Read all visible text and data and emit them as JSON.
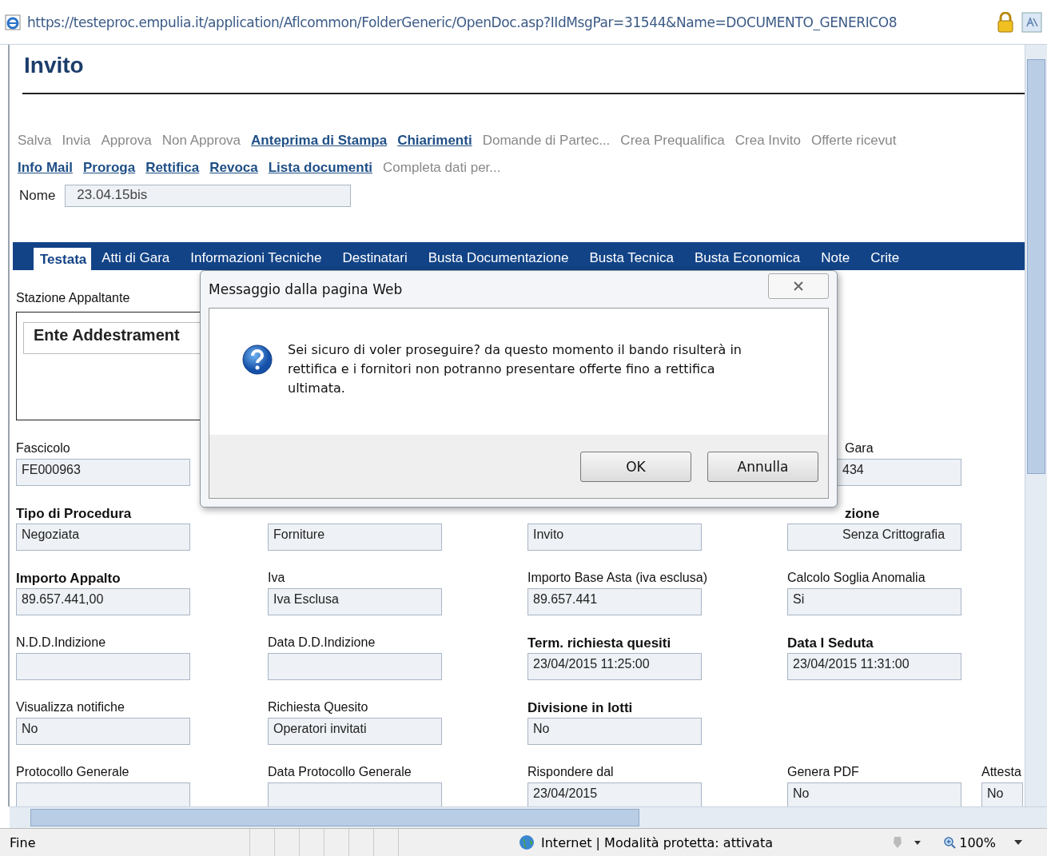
{
  "address_bar": {
    "url": "https://testeproc.empulia.it/application/Aflcommon/FolderGeneric/OpenDoc.asp?IIdMsgPar=31544&Name=DOCUMENTO_GENERICO8"
  },
  "page": {
    "title": "Invito",
    "toolbar": [
      [
        {
          "label": "Salva",
          "disabled": true
        },
        {
          "label": "Invia",
          "disabled": true
        },
        {
          "label": "Approva",
          "disabled": true
        },
        {
          "label": "Non Approva",
          "disabled": true
        },
        {
          "label": "Anteprima di Stampa",
          "disabled": false
        },
        {
          "label": "Chiarimenti",
          "disabled": false
        },
        {
          "label": "Domande di Partec...",
          "disabled": true
        },
        {
          "label": "Crea Prequalifica",
          "disabled": true
        },
        {
          "label": "Crea Invito",
          "disabled": true
        },
        {
          "label": "Offerte ricevut",
          "disabled": true
        }
      ],
      [
        {
          "label": "Info Mail",
          "disabled": false
        },
        {
          "label": "Proroga",
          "disabled": false
        },
        {
          "label": "Rettifica",
          "disabled": false
        },
        {
          "label": "Revoca",
          "disabled": false
        },
        {
          "label": "Lista documenti",
          "disabled": false
        },
        {
          "label": "Completa dati per...",
          "disabled": true
        }
      ]
    ],
    "name_field": {
      "label": "Nome",
      "value": "23.04.15bis"
    },
    "tabs": [
      {
        "label": "Testata",
        "selected": true
      },
      {
        "label": "Atti di Gara",
        "selected": false
      },
      {
        "label": "Informazioni Tecniche",
        "selected": false
      },
      {
        "label": "Destinatari",
        "selected": false
      },
      {
        "label": "Busta Documentazione",
        "selected": false
      },
      {
        "label": "Busta Tecnica",
        "selected": false
      },
      {
        "label": "Busta Economica",
        "selected": false
      },
      {
        "label": "Note",
        "selected": false
      },
      {
        "label": "Crite",
        "selected": false
      }
    ],
    "contracting_station": {
      "label": "Stazione Appaltante",
      "value": "Ente Addestrament"
    },
    "form_rows": [
      [
        {
          "kind": "field",
          "label": "Fascicolo",
          "bold": false,
          "value": "FE000963"
        },
        {
          "kind": "covered"
        },
        {
          "kind": "covered"
        },
        {
          "kind": "clipped",
          "label": "Gara",
          "bold": false,
          "value": "434"
        }
      ],
      [
        {
          "kind": "field",
          "label": "Tipo di Procedura",
          "bold": true,
          "value": "Negoziata"
        },
        {
          "kind": "value_only",
          "value": "Forniture"
        },
        {
          "kind": "value_only",
          "value": "Invito"
        },
        {
          "kind": "clipped",
          "label": "zione",
          "bold": true,
          "value": "Senza Crittografia"
        }
      ],
      [
        {
          "kind": "field",
          "label": "Importo Appalto",
          "bold": true,
          "value": "89.657.441,00"
        },
        {
          "kind": "field",
          "label": "Iva",
          "bold": false,
          "value": "Iva Esclusa"
        },
        {
          "kind": "field",
          "label": "Importo Base Asta (iva esclusa)",
          "bold": false,
          "value": "89.657.441"
        },
        {
          "kind": "field",
          "label": "Calcolo Soglia Anomalia",
          "bold": false,
          "value": "Si"
        }
      ],
      [
        {
          "kind": "field",
          "label": "N.D.D.Indizione",
          "bold": false
        },
        {
          "kind": "field",
          "label": "Data D.D.Indizione",
          "bold": false
        },
        {
          "kind": "field",
          "label": "Term. richiesta quesiti",
          "bold": true,
          "value": "23/04/2015 11:25:00"
        },
        {
          "kind": "field",
          "label": "Data I Seduta",
          "bold": true,
          "value": "23/04/2015 11:31:00"
        }
      ],
      [
        {
          "kind": "field",
          "label": "Visualizza notifiche",
          "bold": false,
          "value": "No"
        },
        {
          "kind": "field",
          "label": "Richiesta Quesito",
          "bold": false,
          "value": "Operatori invitati"
        },
        {
          "kind": "field",
          "label": "Divisione in lotti",
          "bold": true,
          "value": "No"
        }
      ],
      [
        {
          "kind": "field",
          "label": "Protocollo Generale",
          "bold": false
        },
        {
          "kind": "field",
          "label": "Data Protocollo Generale",
          "bold": false
        },
        {
          "kind": "field",
          "label": "Rispondere dal",
          "bold": false,
          "value": "23/04/2015"
        },
        {
          "kind": "field",
          "label": "Genera PDF",
          "bold": false,
          "value": "No"
        },
        {
          "kind": "field",
          "label": "Attesta",
          "bold": false,
          "value": "No"
        }
      ]
    ]
  },
  "dialog": {
    "title": "Messaggio dalla pagina Web",
    "message": "Sei sicuro di voler proseguire? da questo momento il bando risulterà in rettifica e i fornitori non potranno presentare offerte fino a rettifica ultimata.",
    "buttons": [
      "OK",
      "Annulla"
    ]
  },
  "status_bar": {
    "status": "Fine",
    "zone": "Internet | Modalità protetta: attivata",
    "zoom": "100%"
  }
}
